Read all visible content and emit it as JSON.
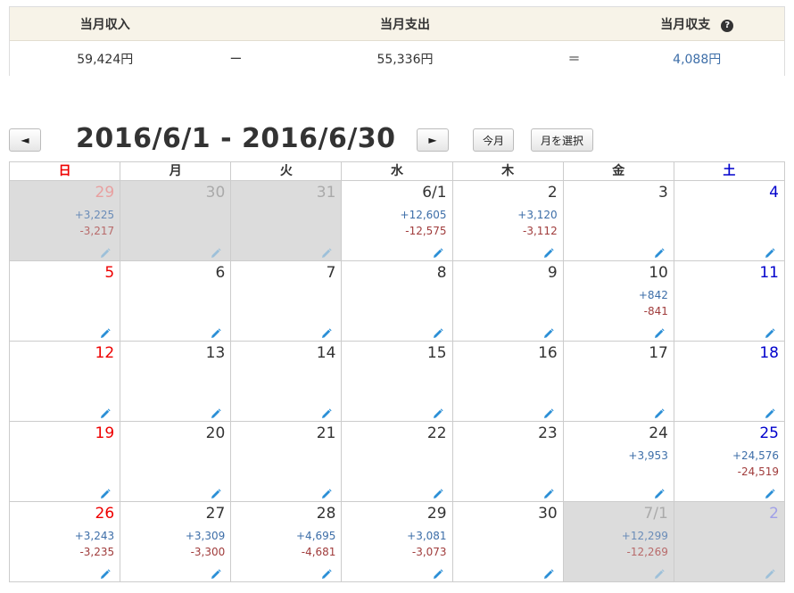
{
  "summary": {
    "income_label": "当月収入",
    "expense_label": "当月支出",
    "balance_label": "当月収支",
    "income_value": "59,424円",
    "minus_sign": "ー",
    "expense_value": "55,336円",
    "equals_sign": "＝",
    "balance_value": "4,088円",
    "help_glyph": "?"
  },
  "nav": {
    "prev_label": "◄",
    "next_label": "►",
    "range_title": "2016/6/1 - 2016/6/30",
    "today_label": "今月",
    "select_month_label": "月を選択"
  },
  "weekdays": [
    "日",
    "月",
    "火",
    "水",
    "木",
    "金",
    "土"
  ],
  "weeks": [
    [
      {
        "date": "29",
        "other": true,
        "income": "+3,225",
        "expense": "-3,217"
      },
      {
        "date": "30",
        "other": true,
        "income": "",
        "expense": ""
      },
      {
        "date": "31",
        "other": true,
        "income": "",
        "expense": ""
      },
      {
        "date": "6/1",
        "other": false,
        "income": "+12,605",
        "expense": "-12,575"
      },
      {
        "date": "2",
        "other": false,
        "income": "+3,120",
        "expense": "-3,112"
      },
      {
        "date": "3",
        "other": false,
        "income": "",
        "expense": ""
      },
      {
        "date": "4",
        "other": false,
        "income": "",
        "expense": ""
      }
    ],
    [
      {
        "date": "5",
        "other": false,
        "income": "",
        "expense": ""
      },
      {
        "date": "6",
        "other": false,
        "income": "",
        "expense": ""
      },
      {
        "date": "7",
        "other": false,
        "income": "",
        "expense": ""
      },
      {
        "date": "8",
        "other": false,
        "income": "",
        "expense": ""
      },
      {
        "date": "9",
        "other": false,
        "income": "",
        "expense": ""
      },
      {
        "date": "10",
        "other": false,
        "income": "+842",
        "expense": "-841"
      },
      {
        "date": "11",
        "other": false,
        "income": "",
        "expense": ""
      }
    ],
    [
      {
        "date": "12",
        "other": false,
        "income": "",
        "expense": ""
      },
      {
        "date": "13",
        "other": false,
        "income": "",
        "expense": ""
      },
      {
        "date": "14",
        "other": false,
        "income": "",
        "expense": ""
      },
      {
        "date": "15",
        "other": false,
        "income": "",
        "expense": ""
      },
      {
        "date": "16",
        "other": false,
        "income": "",
        "expense": ""
      },
      {
        "date": "17",
        "other": false,
        "income": "",
        "expense": ""
      },
      {
        "date": "18",
        "other": false,
        "income": "",
        "expense": ""
      }
    ],
    [
      {
        "date": "19",
        "other": false,
        "income": "",
        "expense": ""
      },
      {
        "date": "20",
        "other": false,
        "income": "",
        "expense": ""
      },
      {
        "date": "21",
        "other": false,
        "income": "",
        "expense": ""
      },
      {
        "date": "22",
        "other": false,
        "income": "",
        "expense": ""
      },
      {
        "date": "23",
        "other": false,
        "income": "",
        "expense": ""
      },
      {
        "date": "24",
        "other": false,
        "income": "+3,953",
        "expense": ""
      },
      {
        "date": "25",
        "other": false,
        "income": "+24,576",
        "expense": "-24,519"
      }
    ],
    [
      {
        "date": "26",
        "other": false,
        "income": "+3,243",
        "expense": "-3,235"
      },
      {
        "date": "27",
        "other": false,
        "income": "+3,309",
        "expense": "-3,300"
      },
      {
        "date": "28",
        "other": false,
        "income": "+4,695",
        "expense": "-4,681"
      },
      {
        "date": "29",
        "other": false,
        "income": "+3,081",
        "expense": "-3,073"
      },
      {
        "date": "30",
        "other": false,
        "income": "",
        "expense": ""
      },
      {
        "date": "7/1",
        "other": true,
        "income": "+12,299",
        "expense": "-12,269"
      },
      {
        "date": "2",
        "other": true,
        "income": "",
        "expense": ""
      }
    ]
  ],
  "icons": {
    "edit": "pencil-icon",
    "help": "question-circle-icon",
    "prev": "arrow-left-icon",
    "next": "arrow-right-icon"
  },
  "colors": {
    "sunday": "#e00000",
    "saturday": "#0000cc",
    "income": "#3d6ea8",
    "expense": "#a03c3c",
    "pencil": "#2b8fd6",
    "header_bg": "#f7f3e8",
    "other_month_bg": "#dcdcdc"
  }
}
